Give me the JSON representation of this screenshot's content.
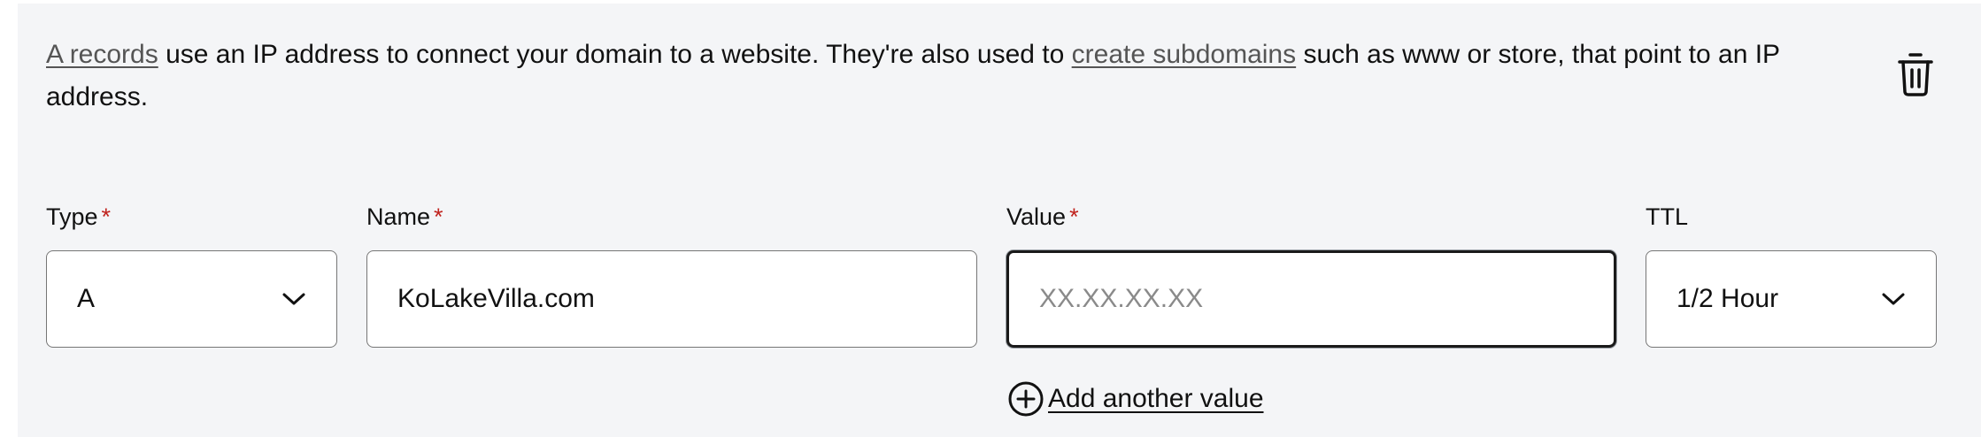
{
  "description": {
    "link_a_records": "A records",
    "text_part1": " use an IP address to connect your domain to a website. They're also used to ",
    "link_create_subdomains": "create subdomains",
    "text_part2": " such as www or store, that point to an IP address."
  },
  "icons": {
    "delete": "trash-icon",
    "dropdown": "chevron-down-icon",
    "add": "plus-circle-icon"
  },
  "fields": {
    "type": {
      "label": "Type",
      "required_mark": "*",
      "value": "A"
    },
    "name": {
      "label": "Name",
      "required_mark": "*",
      "value": "KoLakeVilla.com"
    },
    "value": {
      "label": "Value",
      "required_mark": "*",
      "value": "",
      "placeholder": "XX.XX.XX.XX"
    },
    "ttl": {
      "label": "TTL",
      "value": "1/2 Hour"
    }
  },
  "add_another_value": "Add another value",
  "colors": {
    "panel_background": "#f4f5f7",
    "required_mark": "#c0231e",
    "link_text": "#555555"
  }
}
